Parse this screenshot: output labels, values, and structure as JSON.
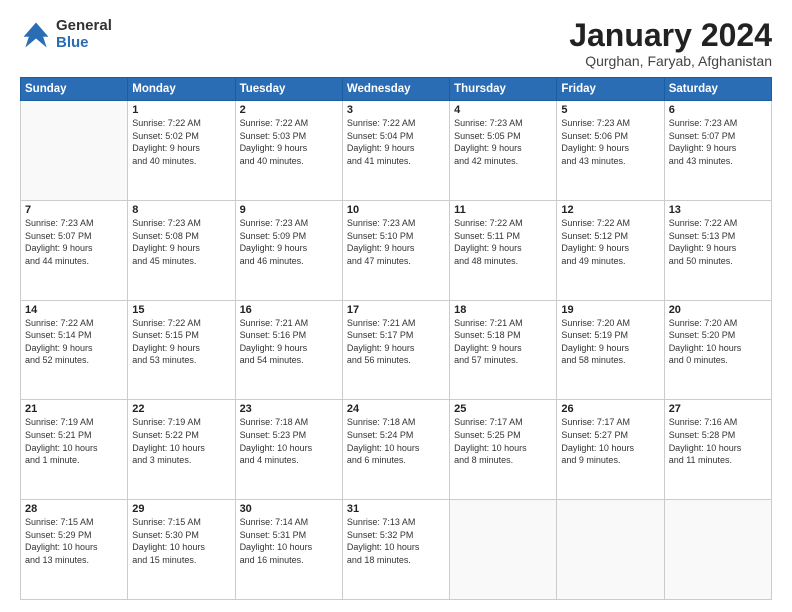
{
  "header": {
    "logo_general": "General",
    "logo_blue": "Blue",
    "month_year": "January 2024",
    "location": "Qurghan, Faryab, Afghanistan"
  },
  "weekdays": [
    "Sunday",
    "Monday",
    "Tuesday",
    "Wednesday",
    "Thursday",
    "Friday",
    "Saturday"
  ],
  "weeks": [
    [
      {
        "day": "",
        "info": ""
      },
      {
        "day": "1",
        "info": "Sunrise: 7:22 AM\nSunset: 5:02 PM\nDaylight: 9 hours\nand 40 minutes."
      },
      {
        "day": "2",
        "info": "Sunrise: 7:22 AM\nSunset: 5:03 PM\nDaylight: 9 hours\nand 40 minutes."
      },
      {
        "day": "3",
        "info": "Sunrise: 7:22 AM\nSunset: 5:04 PM\nDaylight: 9 hours\nand 41 minutes."
      },
      {
        "day": "4",
        "info": "Sunrise: 7:23 AM\nSunset: 5:05 PM\nDaylight: 9 hours\nand 42 minutes."
      },
      {
        "day": "5",
        "info": "Sunrise: 7:23 AM\nSunset: 5:06 PM\nDaylight: 9 hours\nand 43 minutes."
      },
      {
        "day": "6",
        "info": "Sunrise: 7:23 AM\nSunset: 5:07 PM\nDaylight: 9 hours\nand 43 minutes."
      }
    ],
    [
      {
        "day": "7",
        "info": "Sunrise: 7:23 AM\nSunset: 5:07 PM\nDaylight: 9 hours\nand 44 minutes."
      },
      {
        "day": "8",
        "info": "Sunrise: 7:23 AM\nSunset: 5:08 PM\nDaylight: 9 hours\nand 45 minutes."
      },
      {
        "day": "9",
        "info": "Sunrise: 7:23 AM\nSunset: 5:09 PM\nDaylight: 9 hours\nand 46 minutes."
      },
      {
        "day": "10",
        "info": "Sunrise: 7:23 AM\nSunset: 5:10 PM\nDaylight: 9 hours\nand 47 minutes."
      },
      {
        "day": "11",
        "info": "Sunrise: 7:22 AM\nSunset: 5:11 PM\nDaylight: 9 hours\nand 48 minutes."
      },
      {
        "day": "12",
        "info": "Sunrise: 7:22 AM\nSunset: 5:12 PM\nDaylight: 9 hours\nand 49 minutes."
      },
      {
        "day": "13",
        "info": "Sunrise: 7:22 AM\nSunset: 5:13 PM\nDaylight: 9 hours\nand 50 minutes."
      }
    ],
    [
      {
        "day": "14",
        "info": "Sunrise: 7:22 AM\nSunset: 5:14 PM\nDaylight: 9 hours\nand 52 minutes."
      },
      {
        "day": "15",
        "info": "Sunrise: 7:22 AM\nSunset: 5:15 PM\nDaylight: 9 hours\nand 53 minutes."
      },
      {
        "day": "16",
        "info": "Sunrise: 7:21 AM\nSunset: 5:16 PM\nDaylight: 9 hours\nand 54 minutes."
      },
      {
        "day": "17",
        "info": "Sunrise: 7:21 AM\nSunset: 5:17 PM\nDaylight: 9 hours\nand 56 minutes."
      },
      {
        "day": "18",
        "info": "Sunrise: 7:21 AM\nSunset: 5:18 PM\nDaylight: 9 hours\nand 57 minutes."
      },
      {
        "day": "19",
        "info": "Sunrise: 7:20 AM\nSunset: 5:19 PM\nDaylight: 9 hours\nand 58 minutes."
      },
      {
        "day": "20",
        "info": "Sunrise: 7:20 AM\nSunset: 5:20 PM\nDaylight: 10 hours\nand 0 minutes."
      }
    ],
    [
      {
        "day": "21",
        "info": "Sunrise: 7:19 AM\nSunset: 5:21 PM\nDaylight: 10 hours\nand 1 minute."
      },
      {
        "day": "22",
        "info": "Sunrise: 7:19 AM\nSunset: 5:22 PM\nDaylight: 10 hours\nand 3 minutes."
      },
      {
        "day": "23",
        "info": "Sunrise: 7:18 AM\nSunset: 5:23 PM\nDaylight: 10 hours\nand 4 minutes."
      },
      {
        "day": "24",
        "info": "Sunrise: 7:18 AM\nSunset: 5:24 PM\nDaylight: 10 hours\nand 6 minutes."
      },
      {
        "day": "25",
        "info": "Sunrise: 7:17 AM\nSunset: 5:25 PM\nDaylight: 10 hours\nand 8 minutes."
      },
      {
        "day": "26",
        "info": "Sunrise: 7:17 AM\nSunset: 5:27 PM\nDaylight: 10 hours\nand 9 minutes."
      },
      {
        "day": "27",
        "info": "Sunrise: 7:16 AM\nSunset: 5:28 PM\nDaylight: 10 hours\nand 11 minutes."
      }
    ],
    [
      {
        "day": "28",
        "info": "Sunrise: 7:15 AM\nSunset: 5:29 PM\nDaylight: 10 hours\nand 13 minutes."
      },
      {
        "day": "29",
        "info": "Sunrise: 7:15 AM\nSunset: 5:30 PM\nDaylight: 10 hours\nand 15 minutes."
      },
      {
        "day": "30",
        "info": "Sunrise: 7:14 AM\nSunset: 5:31 PM\nDaylight: 10 hours\nand 16 minutes."
      },
      {
        "day": "31",
        "info": "Sunrise: 7:13 AM\nSunset: 5:32 PM\nDaylight: 10 hours\nand 18 minutes."
      },
      {
        "day": "",
        "info": ""
      },
      {
        "day": "",
        "info": ""
      },
      {
        "day": "",
        "info": ""
      }
    ]
  ]
}
